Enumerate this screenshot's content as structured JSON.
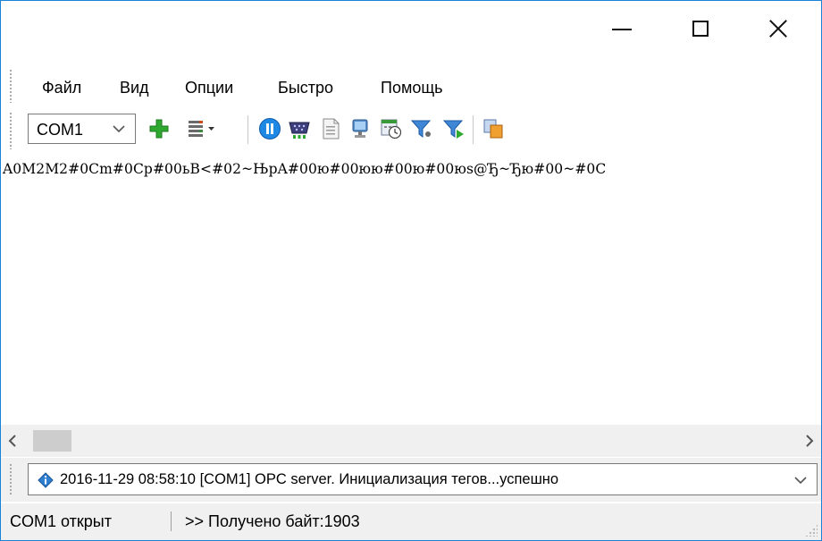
{
  "menu": {
    "file": "Файл",
    "view": "Вид",
    "options": "Опции",
    "quick": "Быстро",
    "help": "Помощь"
  },
  "toolbar": {
    "port_value": "COM1",
    "icons": [
      "add-icon",
      "columns-menu-icon",
      "pause-icon",
      "serial-port-icon",
      "document-icon",
      "monitor-icon",
      "timer-icon",
      "filter-icon",
      "filter-apply-icon",
      "copy-icon"
    ]
  },
  "received_data": "A0M2M2#0Cm#0Cp#00ьB<#02~ЊрA#00ю#00юю#00ю#00юs@Ђ~Ђю#00~#0C",
  "log": {
    "message": "2016-11-29 08:58:10 [COM1] OPC server. Инициализация тегов...успешно"
  },
  "status": {
    "port_state": "COM1 открыт",
    "bytes_received": ">> Получено байт:1903"
  },
  "colors": {
    "accent_border": "#1883d7",
    "add_green": "#2fa82f",
    "pause_blue": "#1e88e5"
  }
}
